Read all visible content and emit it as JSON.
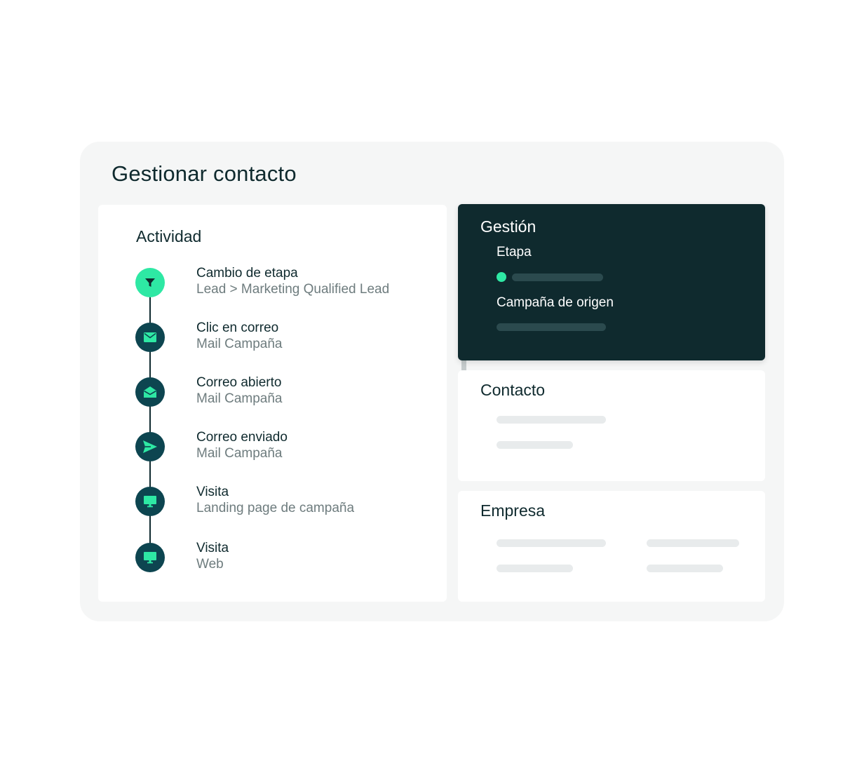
{
  "page": {
    "title": "Gestionar contacto"
  },
  "activity": {
    "title": "Actividad",
    "items": [
      {
        "icon": "funnel-icon",
        "title": "Cambio de etapa",
        "subtitle": "Lead > Marketing Qualified Lead",
        "active": true
      },
      {
        "icon": "mail-icon",
        "title": "Clic en correo",
        "subtitle": "Mail Campaña",
        "active": false
      },
      {
        "icon": "open-mail-icon",
        "title": "Correo abierto",
        "subtitle": "Mail Campaña",
        "active": false
      },
      {
        "icon": "send-icon",
        "title": "Correo enviado",
        "subtitle": "Mail Campaña",
        "active": false
      },
      {
        "icon": "monitor-icon",
        "title": "Visita",
        "subtitle": "Landing page de campaña",
        "active": false
      },
      {
        "icon": "monitor-icon",
        "title": "Visita",
        "subtitle": "Web",
        "active": false
      }
    ]
  },
  "gestion": {
    "title": "Gestión",
    "stage_label": "Etapa",
    "campaign_label": "Campaña de origen"
  },
  "contacto": {
    "title": "Contacto"
  },
  "empresa": {
    "title": "Empresa"
  },
  "colors": {
    "accent": "#2ee8a4",
    "dark": "#0f2a2e",
    "icon_bg": "#0d4550",
    "card_bg": "#f5f6f6",
    "muted_text": "#6e7c7e",
    "placeholder_bar": "#e8ebec"
  }
}
